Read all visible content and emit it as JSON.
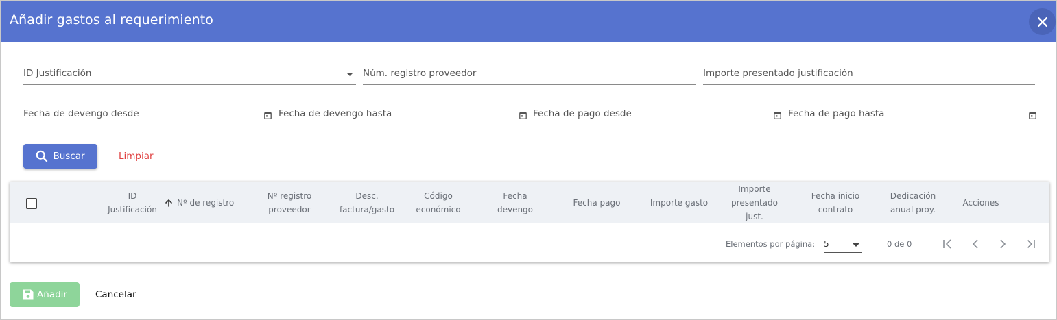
{
  "dialog": {
    "title": "Añadir gastos al requerimiento",
    "close_icon": "close-icon"
  },
  "filters": {
    "id_justificacion": "ID Justificación",
    "num_registro_proveedor": "Núm. registro proveedor",
    "importe_presentado": "Importe presentado justificación",
    "fecha_devengo_desde": "Fecha de devengo desde",
    "fecha_devengo_hasta": "Fecha de devengo hasta",
    "fecha_pago_desde": "Fecha de pago desde",
    "fecha_pago_hasta": "Fecha de pago hasta",
    "calendar_icon": "calendar-icon"
  },
  "actions": {
    "buscar": "Buscar",
    "limpiar": "Limpiar",
    "search_icon": "search-icon"
  },
  "table": {
    "columns": [
      "ID\nJustificación",
      "Nº de registro",
      "Nº registro\nproveedor",
      "Desc.\nfactura/gasto",
      "Código\neconómico",
      "Fecha\ndevengo",
      "Fecha pago",
      "Importe gasto",
      "Importe\npresentado\njust.",
      "Fecha inicio\ncontrato",
      "Dedicación\nanual proy.",
      "Acciones"
    ],
    "rows": [],
    "sort_icon": "arrow-up-icon"
  },
  "paginator": {
    "items_per_page_label": "Elementos por página:",
    "items_per_page_value": "5",
    "range_label": "0 de 0"
  },
  "footer": {
    "anadir": "Añadir",
    "cancelar": "Cancelar",
    "save_icon": "save-icon"
  },
  "colors": {
    "header": "#5673cf",
    "primary_button": "#5673cf",
    "add_button_disabled": "#8ed59a",
    "clear_link": "#e04040"
  }
}
